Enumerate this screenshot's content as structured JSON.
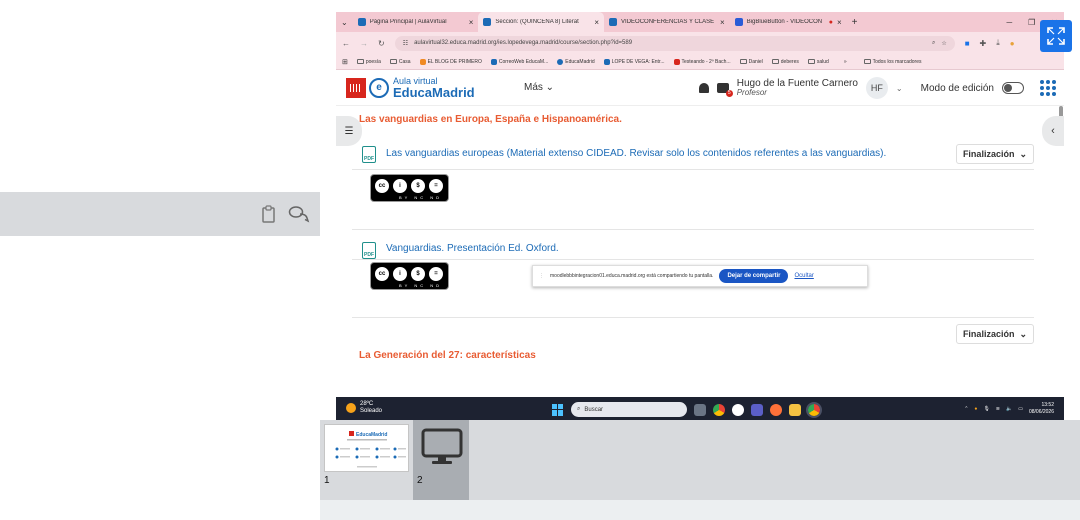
{
  "browser": {
    "tabs": [
      {
        "label": "Página Principal | AulaVirtual",
        "active": false
      },
      {
        "label": "Sección: (QUINCENA 8) Literat",
        "active": true
      },
      {
        "label": "VIDEOCONFERENCIAS Y CLASE",
        "active": false
      },
      {
        "label": "BigBlueButton - VIDEOCON",
        "active": false
      }
    ],
    "new_tab": "+",
    "url": "aulavirtual32.educa.madrid.org/ies.lopedevega.madrid/course/section.php?id=589",
    "bookmarks": [
      "poesía",
      "Casa",
      "EL BLOG DE PRIMERO",
      "CorreoWeb EducaM...",
      "EducaMadrid",
      "LOPE DE VEGA: Entr...",
      "Testeando - 2º Bach...",
      "Daniel",
      "deberes",
      "salud"
    ],
    "bookmarks_more": "»",
    "bookmarks_all": "Todos los marcadores"
  },
  "site": {
    "logo_line1": "Aula virtual",
    "logo_line2": "EducaMadrid",
    "menu_more": "Más ⌄",
    "messages_count": "5",
    "user_name": "Hugo de la Fuente Carnero",
    "user_role": "Profesor",
    "avatar_initials": "HF",
    "edit_mode_label": "Modo de edición"
  },
  "content": {
    "section1_title": "Las vanguardias en Europa, España e Hispanoamérica.",
    "activities": [
      {
        "title": "Las vanguardias europeas (Material extenso CIDEAD. Revisar solo los contenidos referentes a las vanguardias).",
        "completion": "Finalización"
      },
      {
        "title": "Vanguardias. Presentación Ed. Oxford.",
        "completion": ""
      }
    ],
    "completion_label_2": "Finalización",
    "section2_title": "La Generación del 27: características",
    "pdf_label": "PDF",
    "cc_labels": "BY NC ND"
  },
  "share_notice": {
    "text": "moodlebbbintegracion01.educa.madrid.org está compartiendo tu pantalla.",
    "stop_button": "Dejar de compartir",
    "hide_link": "Ocultar"
  },
  "taskbar": {
    "temperature": "28ºC",
    "weather": "Soleado",
    "search_placeholder": "Buscar",
    "time": "13:52",
    "date": "08/06/2026"
  },
  "thumbnails": [
    {
      "number": "1"
    },
    {
      "number": "2"
    }
  ],
  "colors": {
    "accent": "#1a73e8",
    "section_title": "#e85c33",
    "link": "#1c6bb6",
    "tab_bar": "#f3c9d2"
  }
}
